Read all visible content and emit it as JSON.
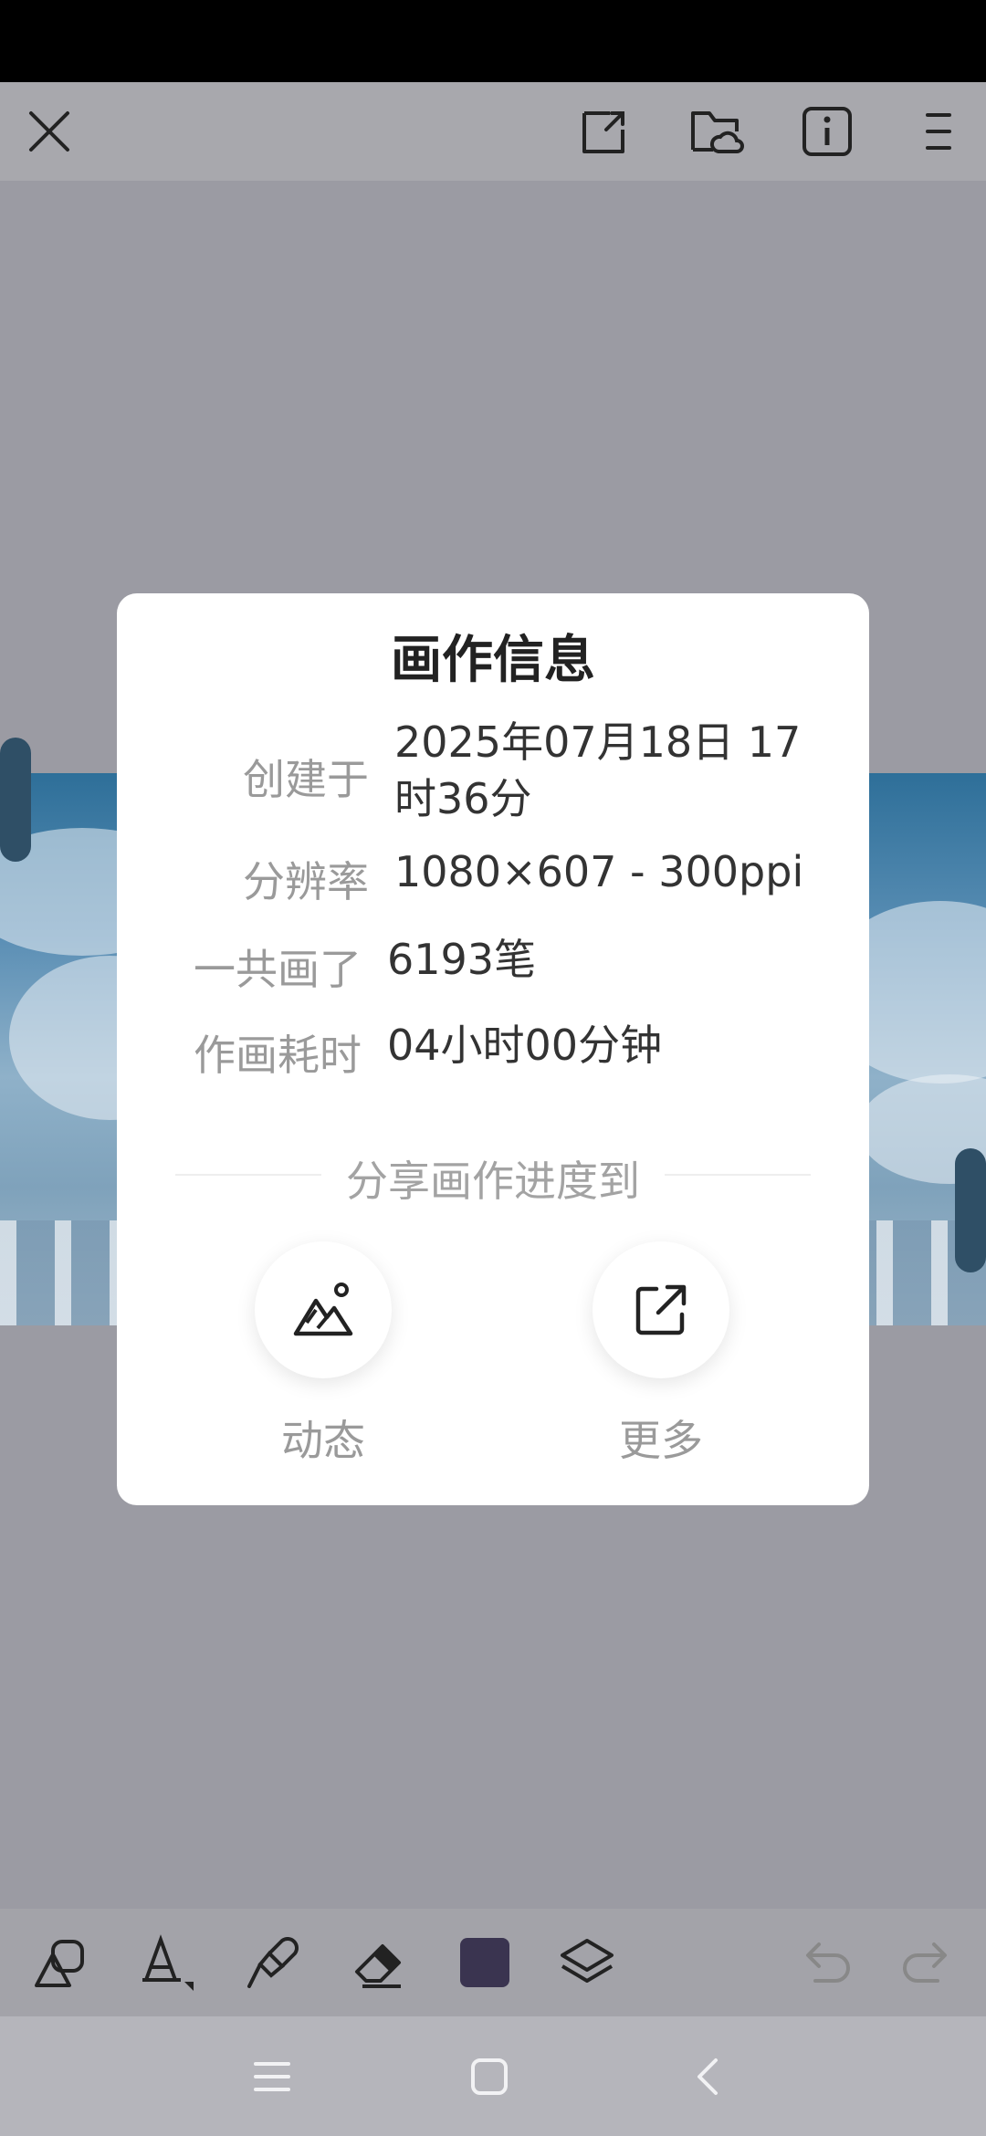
{
  "dialog": {
    "title": "画作信息",
    "rows": [
      {
        "label": "创建于",
        "value": "2025年07月18日 17时36分"
      },
      {
        "label": "分辨率",
        "value": "1080×607 - 300ppi"
      },
      {
        "label": "一共画了",
        "value": "6193笔"
      },
      {
        "label": "作画耗时",
        "value": "04小时00分钟"
      }
    ],
    "share_heading": "分享画作进度到",
    "share_options": [
      {
        "label": "动态",
        "icon": "mountain-icon"
      },
      {
        "label": "更多",
        "icon": "external-link-icon"
      }
    ]
  },
  "colors": {
    "current_color": "#3a3450",
    "overlay": "#9b9ba3"
  },
  "top_bar_icons": [
    "close-icon",
    "export-icon",
    "cloud-folder-icon",
    "info-icon",
    "menu-icon"
  ],
  "bottom_toolbar_icons": [
    "shape-icon",
    "fill-icon",
    "brush-icon",
    "eraser-icon",
    "color-swatch",
    "layers-icon",
    "undo-icon",
    "redo-icon"
  ]
}
